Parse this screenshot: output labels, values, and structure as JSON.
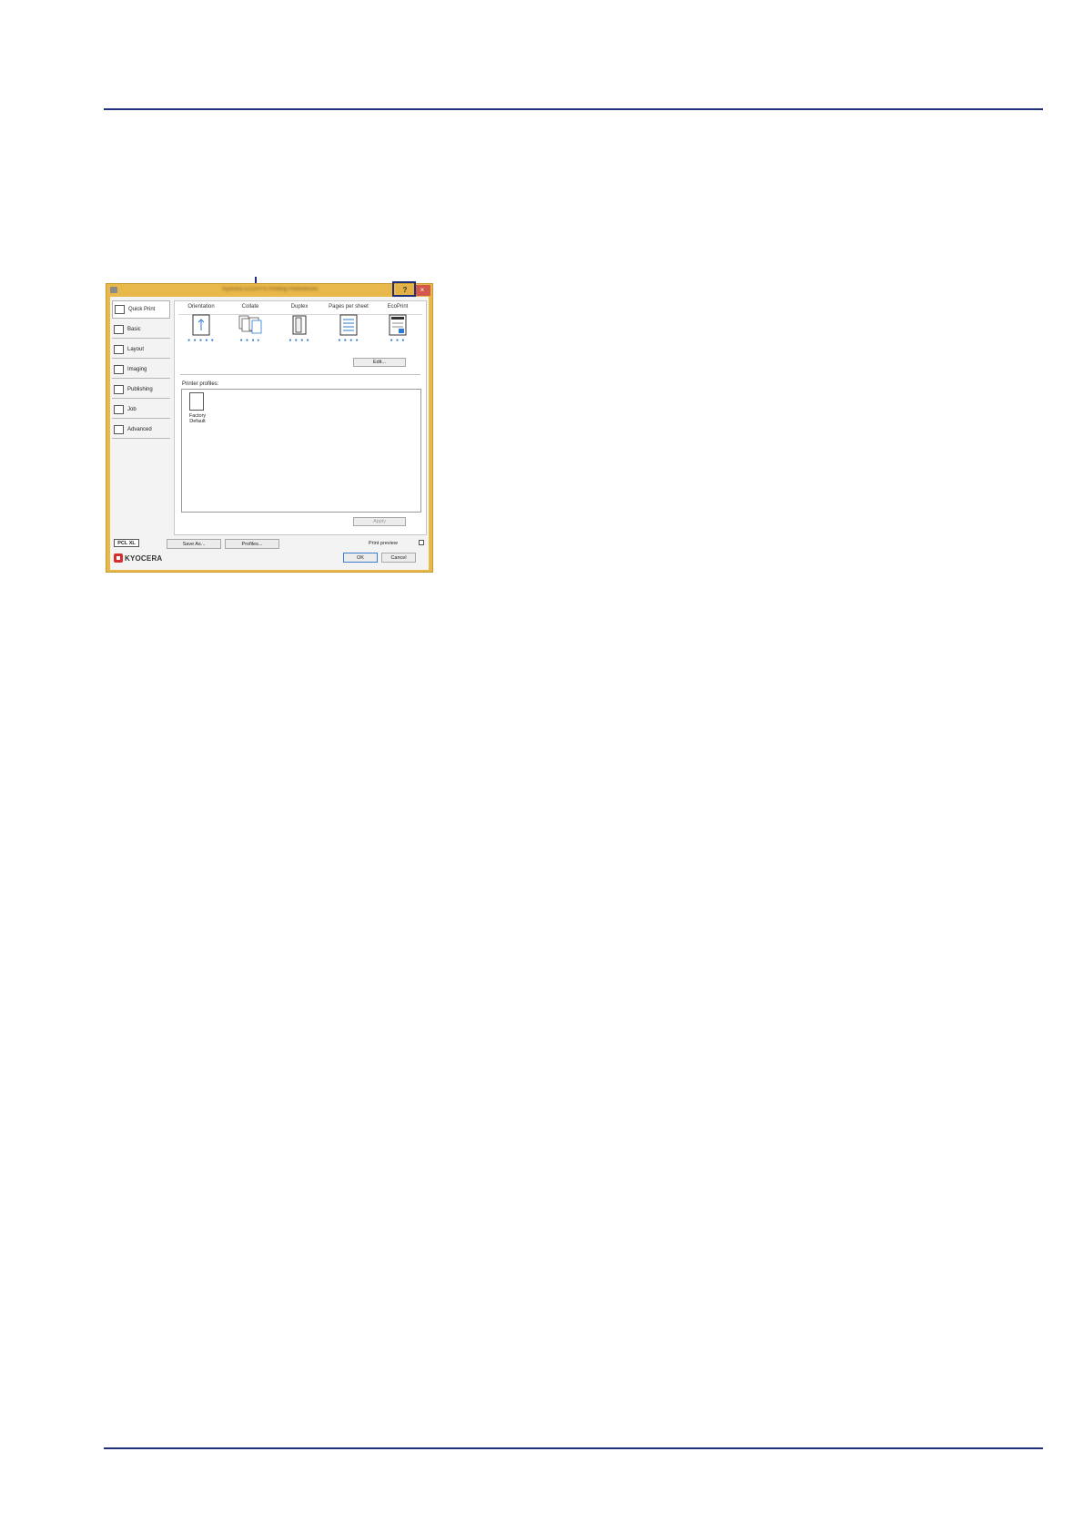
{
  "dialog": {
    "title": "Kyocera ECOSYS Printing Preferences",
    "help_label": "?",
    "close_label": "×"
  },
  "sidebar": {
    "items": [
      {
        "label": "Quick Print",
        "icon": "quick-print-icon"
      },
      {
        "label": "Basic",
        "icon": "basic-icon"
      },
      {
        "label": "Layout",
        "icon": "layout-icon"
      },
      {
        "label": "Imaging",
        "icon": "imaging-icon"
      },
      {
        "label": "Publishing",
        "icon": "publishing-icon"
      },
      {
        "label": "Job",
        "icon": "job-icon"
      },
      {
        "label": "Advanced",
        "icon": "advanced-icon"
      }
    ]
  },
  "quick_print": {
    "columns": [
      {
        "label": "Orientation"
      },
      {
        "label": "Collate"
      },
      {
        "label": "Duplex"
      },
      {
        "label": "Pages per sheet"
      },
      {
        "label": "EcoPrint"
      }
    ],
    "edit_label": "Edit...",
    "profiles_label": "Printer profiles:",
    "profile_name": "Factory Default",
    "apply_label": "Apply"
  },
  "footer": {
    "pdl_badge": "PCL XL",
    "save_as_label": "Save As...",
    "profiles_label": "Profiles...",
    "print_preview_label": "Print preview",
    "ok_label": "OK",
    "cancel_label": "Cancel",
    "brand": "KYOCERA"
  },
  "colors": {
    "rule": "#1f2f7a",
    "titlebar": "#e9b84a",
    "close": "#d1584a",
    "accent_dots": "#2b7bd0"
  }
}
